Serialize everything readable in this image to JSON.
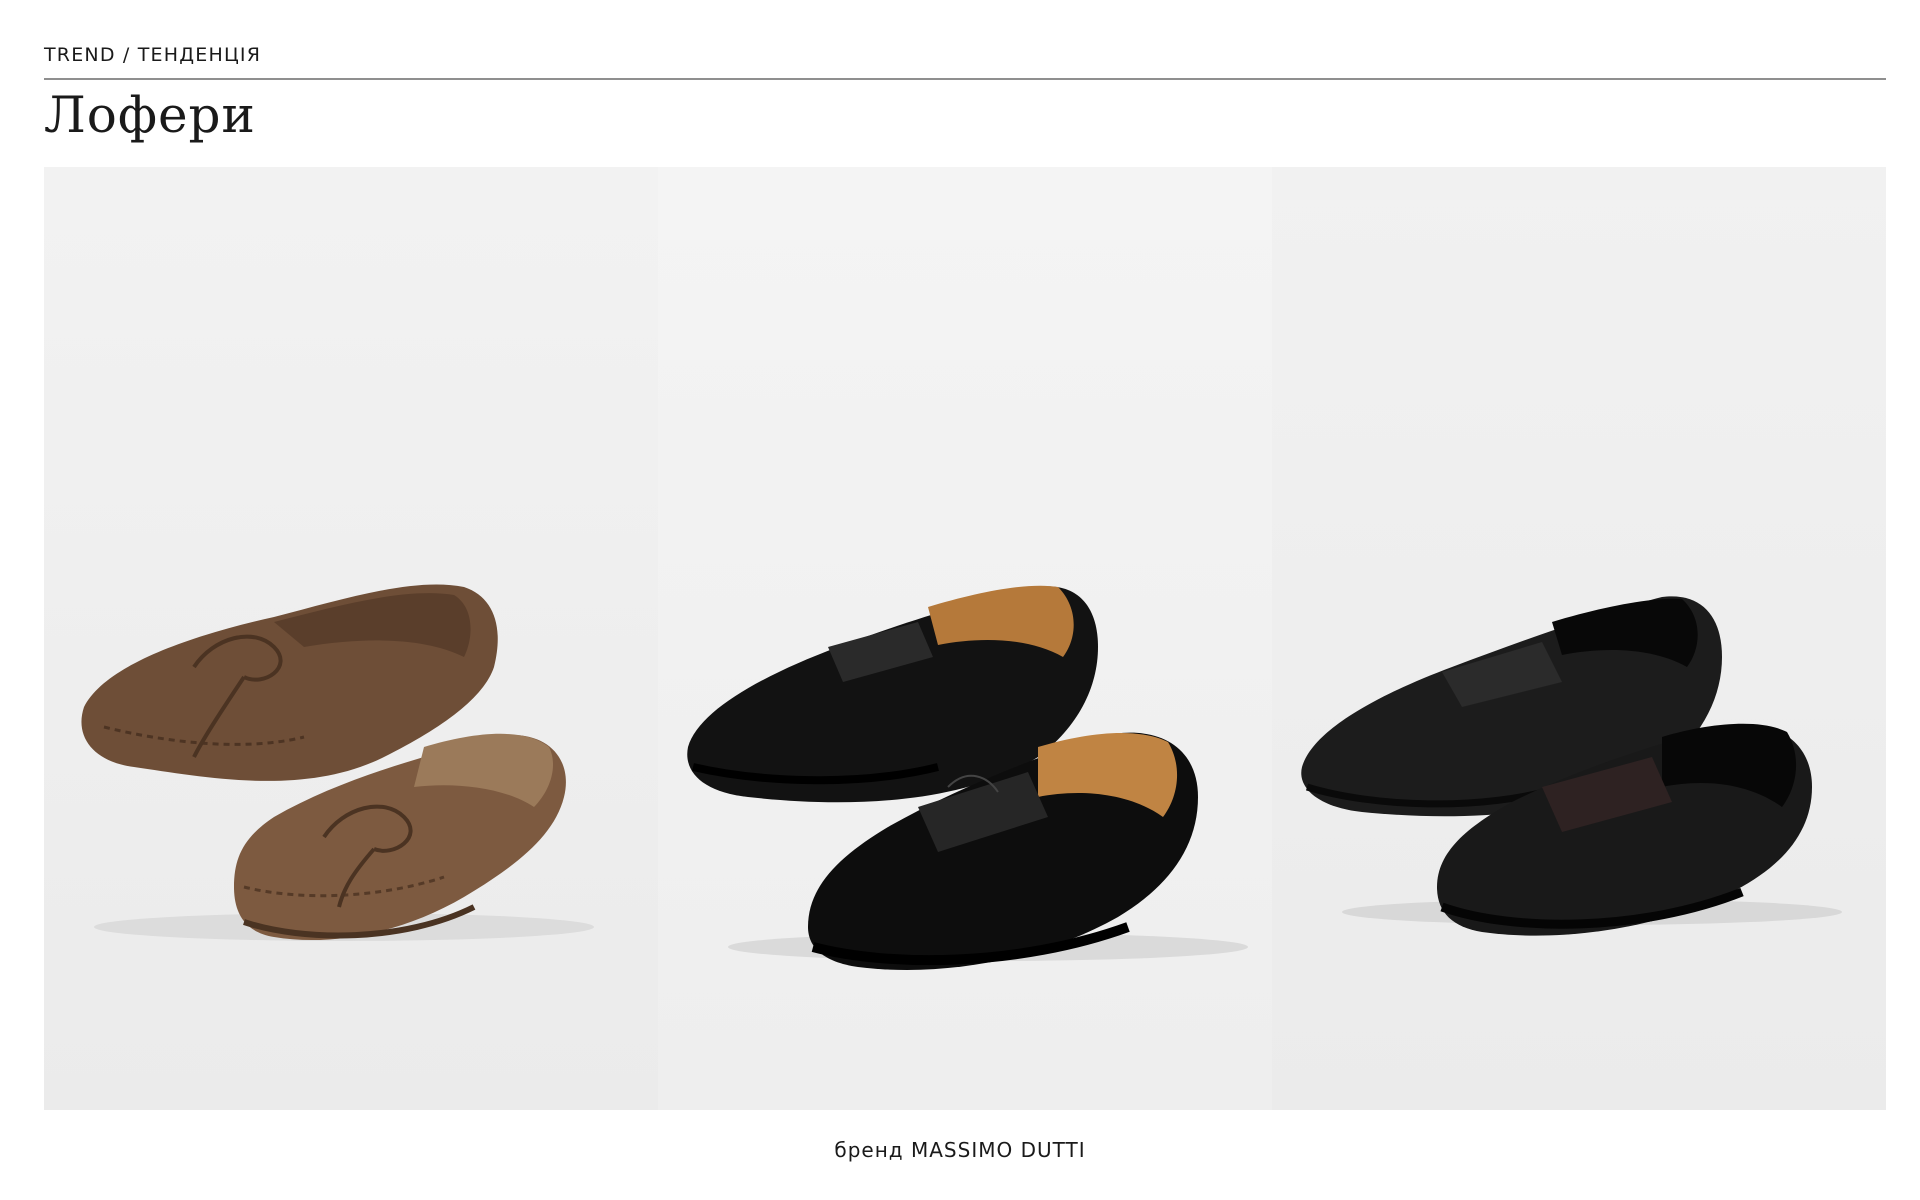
{
  "header": {
    "eyebrow": "TREND / ТЕНДЕНЦІЯ",
    "title": "Лофери"
  },
  "gallery": {
    "items": [
      {
        "icon": "suede-moccasin-loafers-image",
        "color": "#7a5a42"
      },
      {
        "icon": "black-patent-penny-loafers-image",
        "color": "#111111"
      },
      {
        "icon": "black-grained-leather-penny-loafers-image",
        "color": "#1e1e1e"
      }
    ]
  },
  "footer": {
    "caption": "бренд MASSIMO DUTTI"
  }
}
